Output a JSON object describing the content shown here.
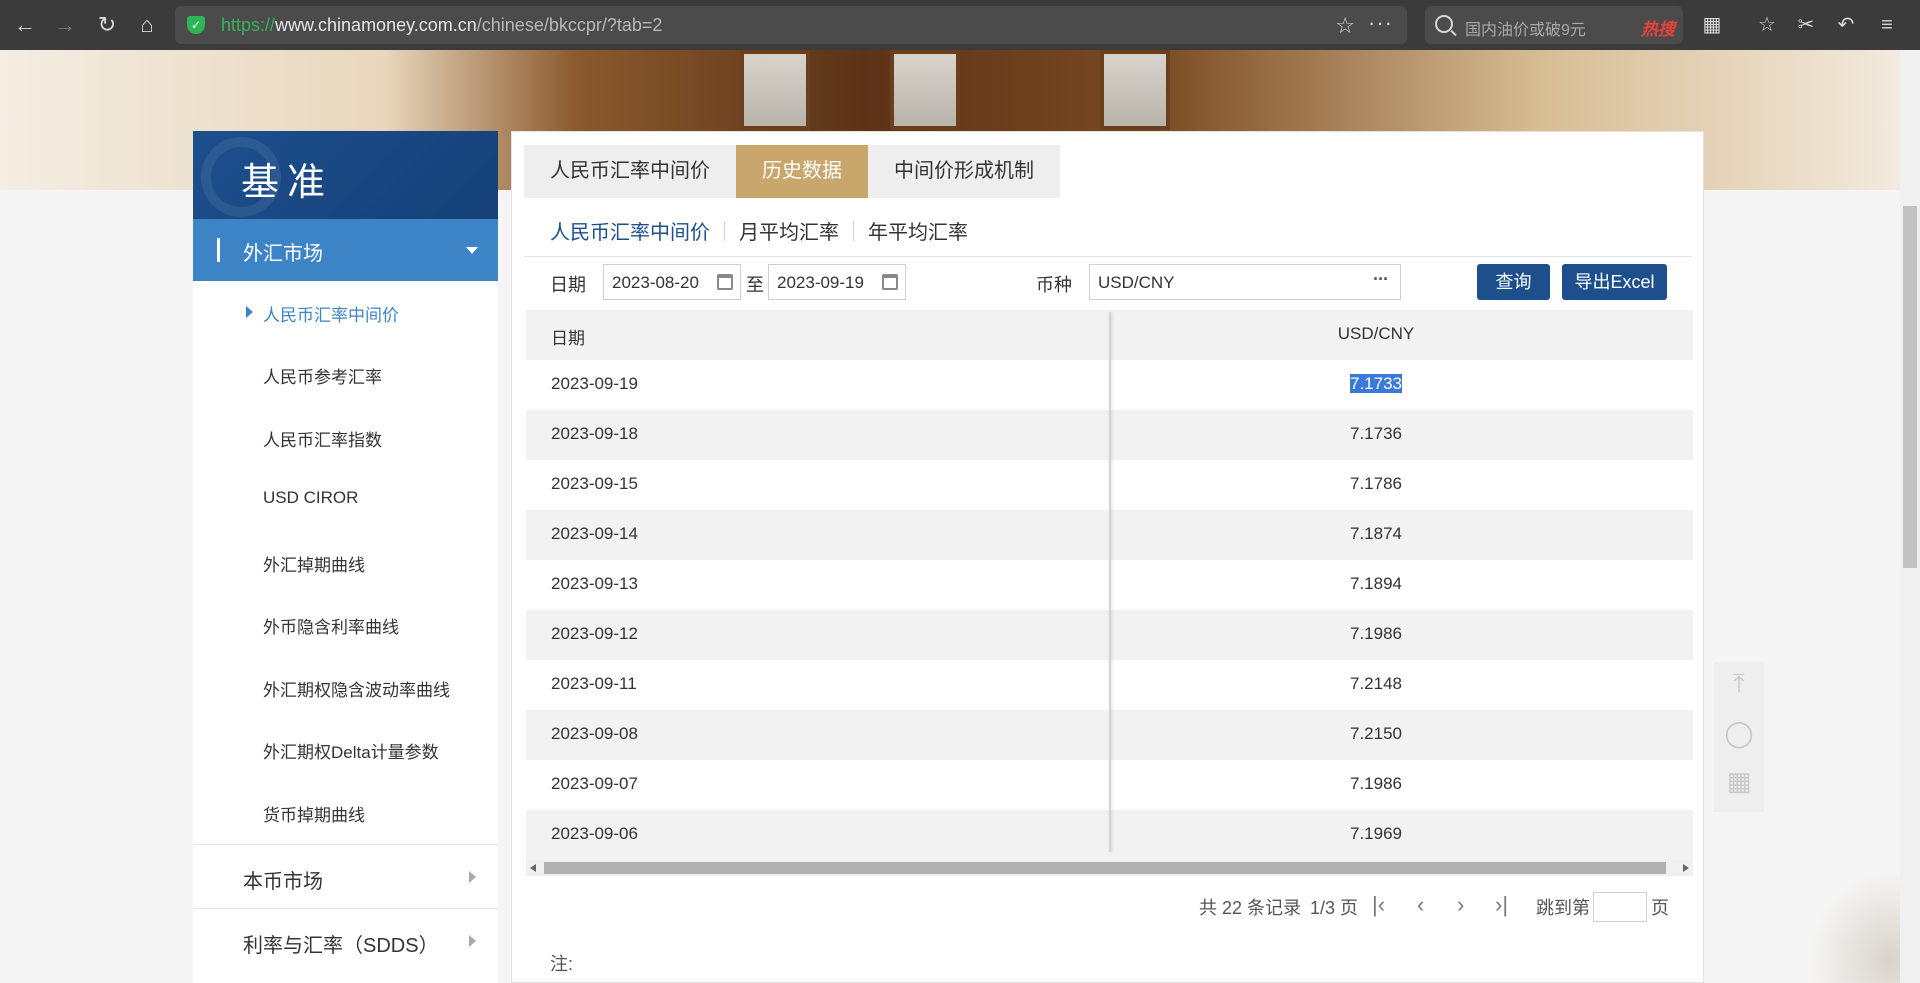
{
  "browser": {
    "url_scheme": "https://",
    "url_host": "www.chinamoney.com.cn",
    "url_path": "/chinese/bkccpr/?tab=2",
    "search_placeholder": "国内油价或破9元",
    "hot_label": "热搜"
  },
  "sidebar": {
    "title": "基准",
    "active_section": "外汇市场",
    "items": [
      {
        "label": "人民币汇率中间价",
        "current": true
      },
      {
        "label": "人民币参考汇率"
      },
      {
        "label": "人民币汇率指数"
      },
      {
        "label": "USD CIROR"
      },
      {
        "label": "外汇掉期曲线"
      },
      {
        "label": "外币隐含利率曲线"
      },
      {
        "label": "外汇期权隐含波动率曲线"
      },
      {
        "label": "外汇期权Delta计量参数"
      },
      {
        "label": "货币掉期曲线"
      }
    ],
    "sections": [
      "本币市场",
      "利率与汇率（SDDS）"
    ]
  },
  "main": {
    "tabs": [
      "人民币汇率中间价",
      "历史数据",
      "中间价形成机制"
    ],
    "active_tab": "历史数据",
    "subtabs": [
      "人民币汇率中间价",
      "月平均汇率",
      "年平均汇率"
    ],
    "filter": {
      "date_label": "日期",
      "start_date": "2023-08-20",
      "to_label": "至",
      "end_date": "2023-09-19",
      "currency_label": "币种",
      "currency_value": "USD/CNY",
      "query_button": "查询",
      "export_button": "导出Excel"
    },
    "table": {
      "headers": [
        "日期",
        "USD/CNY"
      ],
      "rows": [
        {
          "date": "2023-09-19",
          "value": "7.1733"
        },
        {
          "date": "2023-09-18",
          "value": "7.1736"
        },
        {
          "date": "2023-09-15",
          "value": "7.1786"
        },
        {
          "date": "2023-09-14",
          "value": "7.1874"
        },
        {
          "date": "2023-09-13",
          "value": "7.1894"
        },
        {
          "date": "2023-09-12",
          "value": "7.1986"
        },
        {
          "date": "2023-09-11",
          "value": "7.2148"
        },
        {
          "date": "2023-09-08",
          "value": "7.2150"
        },
        {
          "date": "2023-09-07",
          "value": "7.1986"
        },
        {
          "date": "2023-09-06",
          "value": "7.1969"
        }
      ]
    },
    "pager": {
      "total": "共 22 条记录",
      "page": "1/3 页",
      "jump_label": "跳到第",
      "page_unit": "页"
    },
    "note": "注:"
  },
  "colors": {
    "brand_blue": "#1d4f8d",
    "active_blue": "#3d84c6",
    "tab_gold": "#c9a66b"
  }
}
